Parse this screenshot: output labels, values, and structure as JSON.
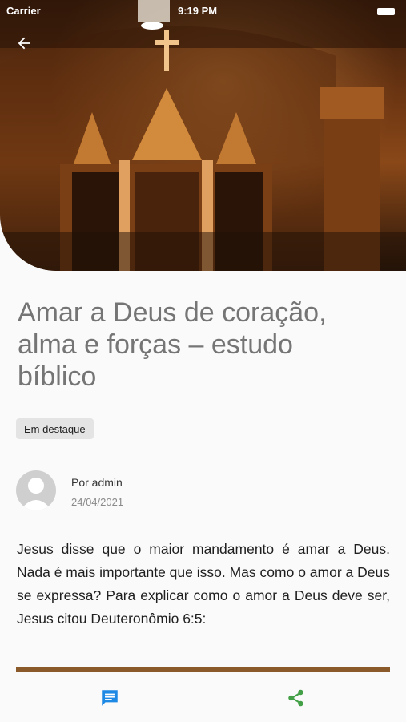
{
  "status_bar": {
    "carrier": "Carrier",
    "time": "9:19 PM"
  },
  "header": {
    "back_icon": "arrow-left-icon"
  },
  "post": {
    "title": "Amar a Deus de coração, alma e forças – estudo bíblico",
    "badge": "Em destaque",
    "author": "Por admin",
    "date": "24/04/2021",
    "body": "Jesus disse que o maior mandamento é amar a Deus. Nada é mais importante que isso. Mas como o amor a Deus se expressa? Para explicar como o amor a Deus deve ser, Jesus citou Deuteronômio 6:5:"
  },
  "bottom_bar": {
    "comment_icon": "comment-icon",
    "share_icon": "share-icon"
  },
  "colors": {
    "comment_accent": "#1e88e5",
    "share_accent": "#43a047",
    "title_text": "#757575"
  }
}
